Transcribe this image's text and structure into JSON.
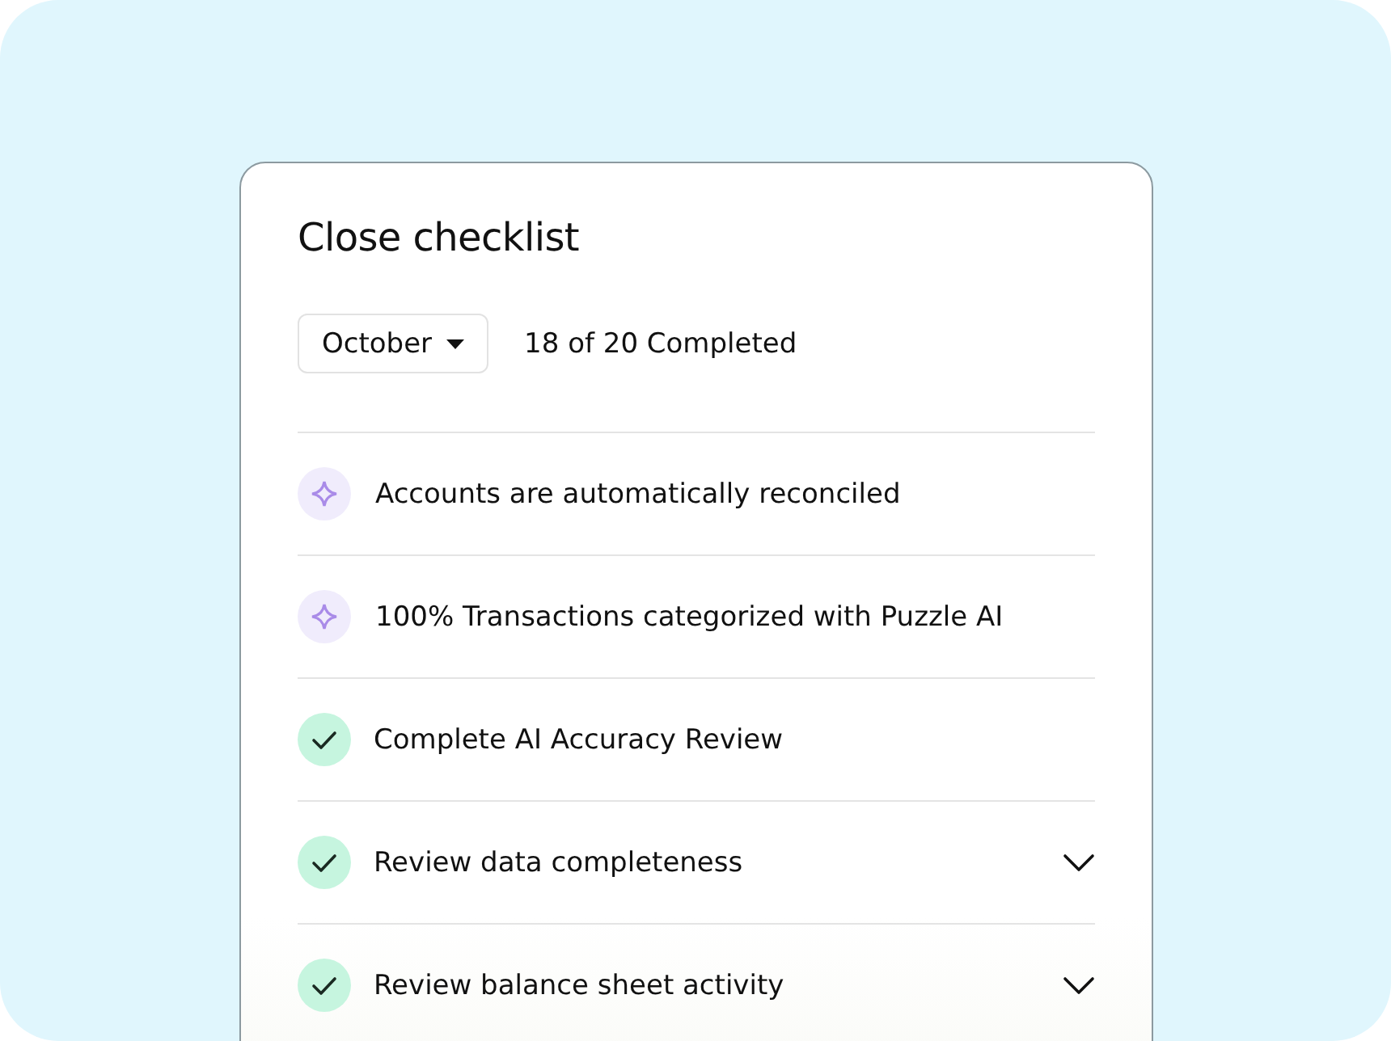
{
  "card": {
    "title": "Close checklist",
    "month_picker": {
      "value": "October"
    },
    "progress_text": "18 of 20 Completed"
  },
  "items": [
    {
      "kind": "ai",
      "label": "Accounts are automatically reconciled",
      "expandable": false
    },
    {
      "kind": "ai",
      "label": "100% Transactions categorized with Puzzle AI",
      "expandable": false
    },
    {
      "kind": "done",
      "label": "Complete AI Accuracy Review",
      "expandable": false
    },
    {
      "kind": "done",
      "label": "Review data completeness",
      "expandable": true
    },
    {
      "kind": "done",
      "label": "Review balance sheet activity",
      "expandable": true
    }
  ]
}
